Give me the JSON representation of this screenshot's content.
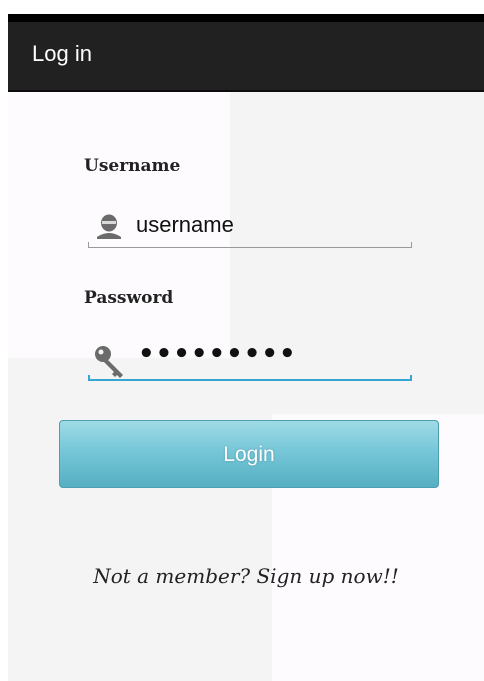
{
  "app": {
    "title": "Log in"
  },
  "form": {
    "username_label": "Username",
    "username_value": "username",
    "password_label": "Password",
    "password_value": "•••••••••",
    "login_label": "Login",
    "signup_text": "Not a member? Sign up now!!"
  },
  "icons": {
    "username": "person-icon",
    "password": "key-icon"
  },
  "colors": {
    "titlebar": "#212121",
    "focus_underline": "#33a6d1",
    "button_top": "#9fdbe6",
    "button_bottom": "#56afc2"
  }
}
